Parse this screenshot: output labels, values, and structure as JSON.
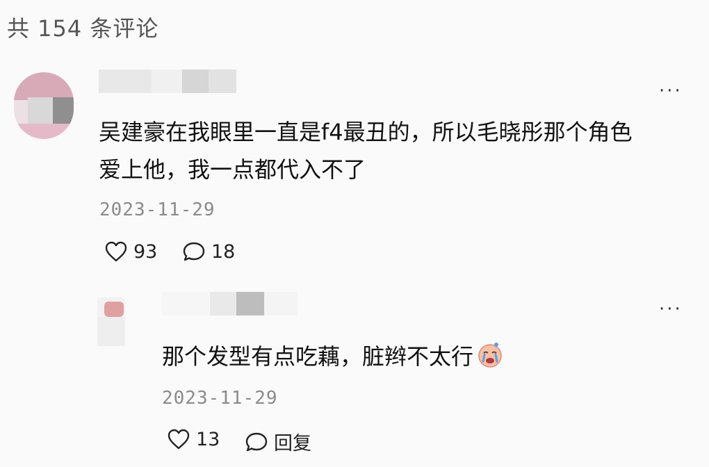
{
  "header": {
    "count_label": "共 154 条评论"
  },
  "comments": [
    {
      "avatar_icon": "avatar-icon",
      "text_lines": [
        "吴建豪在我眼里一直是f4最丑的，所以毛晓彤那个角色",
        "爱上他，我一点都代入不了"
      ],
      "date": "2023-11-29",
      "likes": "93",
      "replies": "18",
      "more_icon": "more-icon"
    },
    {
      "avatar_icon": "avatar-icon",
      "text": "那个发型有点吃藕，脏辫不太行",
      "emoji": "crying-face-icon",
      "date": "2023-11-29",
      "likes": "13",
      "reply_label": "回复",
      "more_icon": "more-icon"
    }
  ],
  "colors": {
    "background": "#fafafa",
    "date": "#8a8a8a",
    "text": "#111111"
  }
}
